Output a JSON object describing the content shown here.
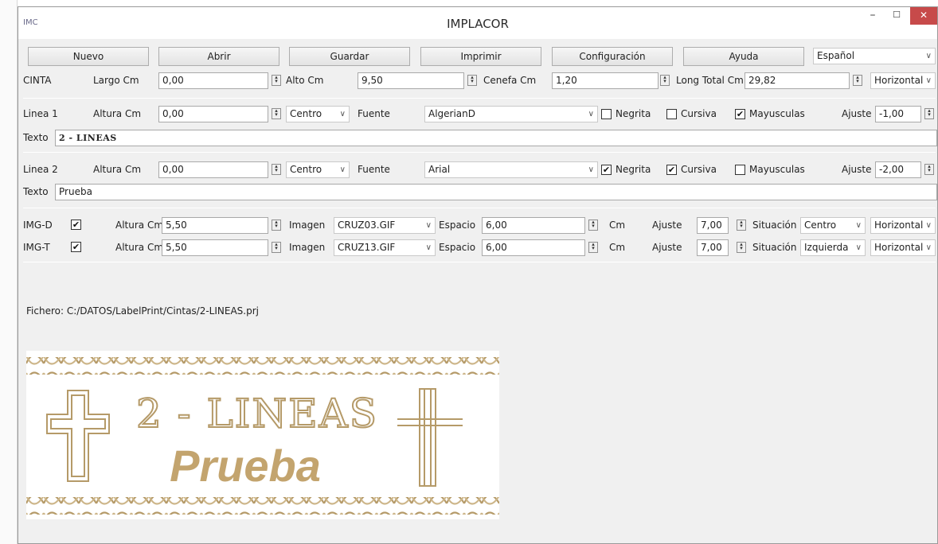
{
  "window": {
    "title": "IMPLACOR",
    "app_icon": "IMC",
    "minimize": "–",
    "maximize": "☐",
    "close": "✕"
  },
  "toolbar": {
    "nuevo": "Nuevo",
    "abrir": "Abrir",
    "guardar": "Guardar",
    "imprimir": "Imprimir",
    "configuracion": "Configuración",
    "ayuda": "Ayuda",
    "language": "Español"
  },
  "cinta": {
    "label": "CINTA",
    "largo_label": "Largo Cm",
    "largo": "0,00",
    "alto_label": "Alto Cm",
    "alto": "9,50",
    "cenefa_label": "Cenefa Cm",
    "cenefa": "1,20",
    "long_total_label": "Long Total Cm",
    "long_total": "29,82",
    "orientation": "Horizontal"
  },
  "linea1": {
    "label": "Linea 1",
    "altura_label": "Altura Cm",
    "altura": "0,00",
    "align": "Centro",
    "fuente_label": "Fuente",
    "fuente": "AlgerianD",
    "negrita_label": "Negrita",
    "negrita": false,
    "cursiva_label": "Cursiva",
    "cursiva": false,
    "mayusculas_label": "Mayusculas",
    "mayusculas": true,
    "ajuste_label": "Ajuste",
    "ajuste": "-1,00",
    "texto_label": "Texto",
    "texto": "2 - LINEAS"
  },
  "linea2": {
    "label": "Linea 2",
    "altura_label": "Altura Cm",
    "altura": "0,00",
    "align": "Centro",
    "fuente_label": "Fuente",
    "fuente": "Arial",
    "negrita_label": "Negrita",
    "negrita": true,
    "cursiva_label": "Cursiva",
    "cursiva": true,
    "mayusculas_label": "Mayusculas",
    "mayusculas": false,
    "ajuste_label": "Ajuste",
    "ajuste": "-2,00",
    "texto_label": "Texto",
    "texto": "Prueba"
  },
  "img_d": {
    "label": "IMG-D",
    "checked": true,
    "altura_label": "Altura Cm",
    "altura": "5,50",
    "imagen_label": "Imagen",
    "imagen": "CRUZ03.GIF",
    "espacio_label": "Espacio",
    "espacio": "6,00",
    "cm_label": "Cm",
    "ajuste_label": "Ajuste",
    "ajuste": "7,00",
    "situacion_label": "Situación",
    "situacion": "Centro",
    "orientation": "Horizontal"
  },
  "img_t": {
    "label": "IMG-T",
    "checked": true,
    "altura_label": "Altura Cm",
    "altura": "5,50",
    "imagen_label": "Imagen",
    "imagen": "CRUZ13.GIF",
    "espacio_label": "Espacio",
    "espacio": "6,00",
    "cm_label": "Cm",
    "ajuste_label": "Ajuste",
    "ajuste": "7,00",
    "situacion_label": "Situación",
    "situacion": "Izquierda",
    "orientation": "Horizontal"
  },
  "fichero": "Fichero: C:/DATOS/LabelPrint/Cintas/2-LINEAS.prj",
  "preview": {
    "line1": "2 - LINEAS",
    "line2": "Prueba"
  },
  "icons": {
    "spin": "spin-updown-icon",
    "chevron": "chevron-down-icon",
    "check": "✔"
  },
  "colors": {
    "gold": "#b59a68",
    "window_bg": "#f0f0f0",
    "close_button": "#c74a4a"
  }
}
